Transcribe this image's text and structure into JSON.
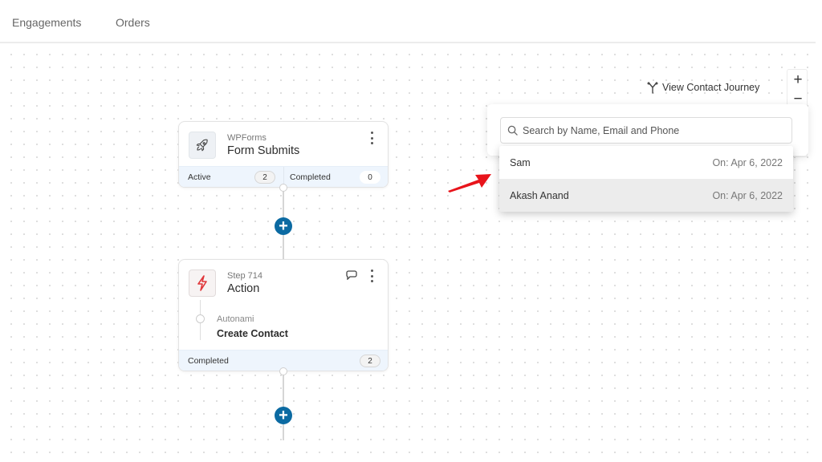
{
  "tabs": [
    {
      "label": "Engagements"
    },
    {
      "label": "Orders"
    }
  ],
  "workflow": {
    "trigger_card": {
      "source": "WPForms",
      "title": "Form Submits",
      "icon": "rocket-icon",
      "stats": [
        {
          "label": "Active",
          "count": "2"
        },
        {
          "label": "Completed",
          "count": "0"
        }
      ]
    },
    "action_card": {
      "step": "Step 714",
      "title": "Action",
      "icon": "lightning-icon",
      "sub_action": {
        "source": "Autonami",
        "title": "Create Contact"
      },
      "stats": [
        {
          "label": "Completed",
          "count": "2"
        }
      ]
    },
    "add_step_symbol": "+"
  },
  "journey": {
    "link_label": "View Contact Journey",
    "icon": "fork-icon"
  },
  "zoom_controls": {
    "zoom_in": "+",
    "zoom_out": "−"
  },
  "search": {
    "placeholder": "Search by Name, Email and Phone",
    "value": "",
    "results": [
      {
        "name": "Sam",
        "date": "On: Apr 6, 2022"
      },
      {
        "name": "Akash Anand",
        "date": "On: Apr 6, 2022"
      }
    ]
  },
  "annotation": {
    "arrow_color": "#e8141b"
  },
  "colors": {
    "accent": "#0b6aa2",
    "footer_bg": "#eef5fd",
    "action_icon": "#e0373b"
  }
}
